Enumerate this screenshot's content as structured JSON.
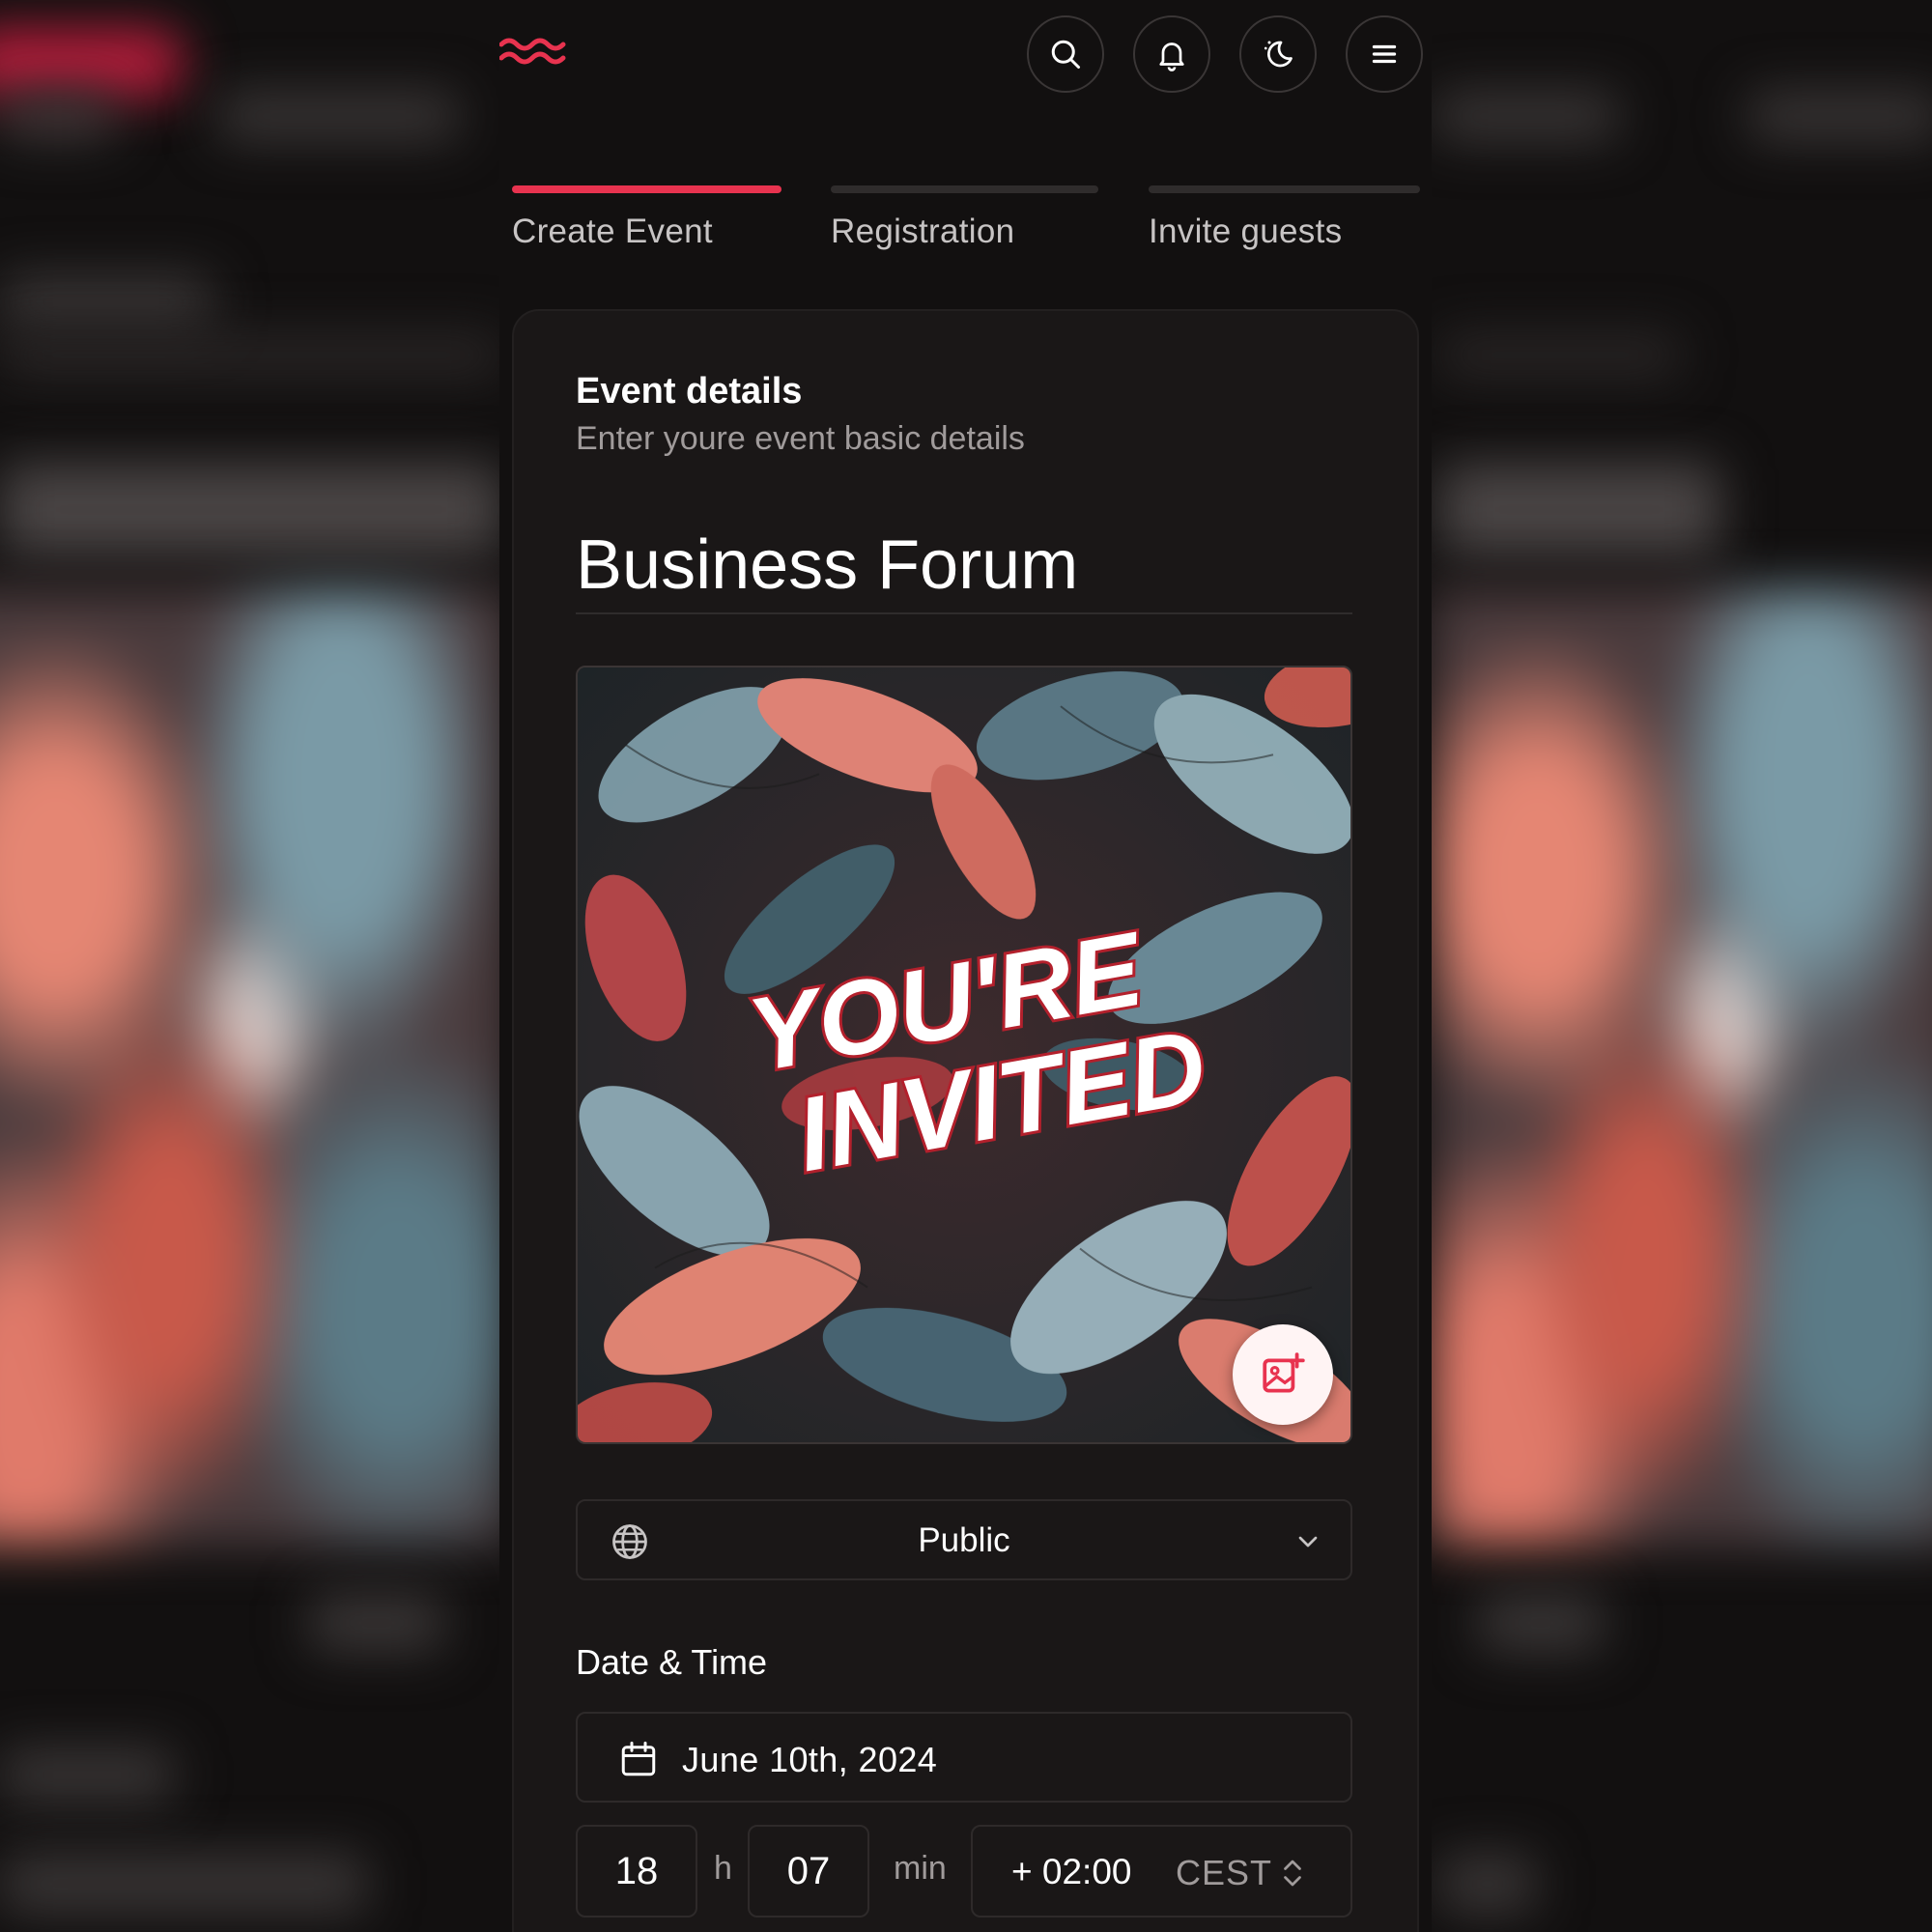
{
  "colors": {
    "accent": "#e8334f",
    "background": "#121010",
    "card": "#1a1717",
    "muted_text": "#a09b9b"
  },
  "header": {
    "logo_icon": "wave-logo-icon",
    "icons": [
      "search-icon",
      "bell-icon",
      "theme-moon-icon",
      "menu-icon"
    ]
  },
  "tabs": [
    {
      "label": "Create Event",
      "active": true
    },
    {
      "label": "Registration",
      "active": false
    },
    {
      "label": "Invite guests",
      "active": false
    }
  ],
  "event_details": {
    "title": "Event details",
    "subtitle": "Enter youre event basic details",
    "name": "Business Forum",
    "cover": {
      "headline_line1": "YOU'RE",
      "headline_line2": "INVITED",
      "action_icon": "add-image-icon"
    },
    "visibility": {
      "icon": "globe-icon",
      "value": "Public",
      "chevron": "chevron-down-icon"
    }
  },
  "date_time": {
    "label": "Date & Time",
    "date": "June 10th, 2024",
    "date_icon": "calendar-icon",
    "hours": "18",
    "hours_unit": "h",
    "minutes": "07",
    "minutes_unit": "min",
    "tz_offset": "+ 02:00",
    "tz_abbr": "CEST",
    "tz_icon": "up-down-chevron-icon"
  }
}
